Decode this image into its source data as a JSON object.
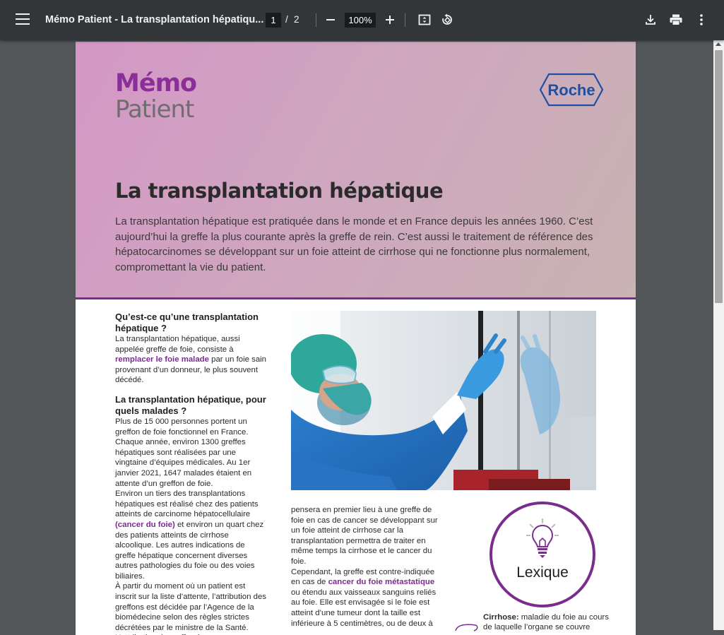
{
  "viewer": {
    "title": "Mémo Patient - La transplantation hépatiqu...",
    "current_page": "1",
    "page_separator": "/",
    "total_pages": "2",
    "zoom": "100%"
  },
  "document": {
    "brand_line1": "Mémo",
    "brand_line2": "Patient",
    "logo_text": "Roche",
    "title": "La transplantation hépatique",
    "intro": "La transplantation hépatique est pratiquée dans le monde et en France depuis les années 1960. C’est aujourd’hui la greffe la plus courante après la greffe de rein. C’est aussi le traitement de référence des hépatocarcinomes se développant sur un foie atteint de cirrhose qui ne fonctionne plus normalement, compromettant la vie du patient.",
    "section1": {
      "heading": "Qu’est-ce qu’une transplantation hépatique ?",
      "text_before": "La transplantation hépatique, aussi appelée greffe de foie, consiste à ",
      "highlight": "remplacer le foie malade",
      "text_after": " par un foie sain provenant d’un donneur, le plus souvent décédé."
    },
    "section2": {
      "heading": "La transplantation hépatique, pour quels malades ?",
      "para1": "Plus de 15 000 personnes portent un greffon de foie fonctionnel en France. Chaque année, environ 1300 greffes hépatiques sont réalisées par une vingtaine d’équipes médicales. Au 1er janvier 2021, 1647 malades étaient en attente d’un greffon de foie.",
      "para2_before": "Environ un tiers des transplantations hépatiques est réalisé chez des patients atteints de carcinome hépatocellulaire ",
      "para2_highlight": "(cancer du foie)",
      "para2_after": " et environ un quart chez des patients atteints de cirrhose alcoolique. Les autres indications de greffe hépatique concernent diverses autres pathologies du foie ou des voies biliaires.",
      "para3": "À partir du moment où un patient est inscrit sur la liste d’attente, l’attribution des greffons est décidée par l’Agence de la biomédecine selon des règles strictes décrétées par le ministre de la Santé. L’attribution du greffon à un receveur prend"
    },
    "middle": {
      "text1": "pensera en premier lieu à une greffe de foie en cas de cancer se développant sur un foie atteint de cirrhose car la transplantation permettra de traiter en même temps la cirrhose et le cancer du foie.",
      "text2_before": "Cependant, la greffe est contre-indiquée en cas de ",
      "text2_highlight": "cancer du foie métastatique",
      "text2_after": " ou étendu aux vaisseaux sanguins reliés au foie. Elle est envisagée si le foie est atteint d’une tumeur dont la taille est inférieure à 5 centimètres, ou de deux à"
    },
    "lexique": {
      "label": "Lexique",
      "term": "Cirrhose:",
      "definition": " maladie du foie au cours de laquelle l’organe se couvre"
    }
  },
  "colors": {
    "accent": "#7b2d8e",
    "toolbar": "#323639",
    "viewer_bg": "#525659",
    "roche_blue": "#1f4fa2"
  },
  "icons": [
    "menu-icon",
    "zoom-out-icon",
    "zoom-in-icon",
    "fit-page-icon",
    "rotate-icon",
    "download-icon",
    "print-icon",
    "more-icon",
    "lightbulb-icon"
  ]
}
